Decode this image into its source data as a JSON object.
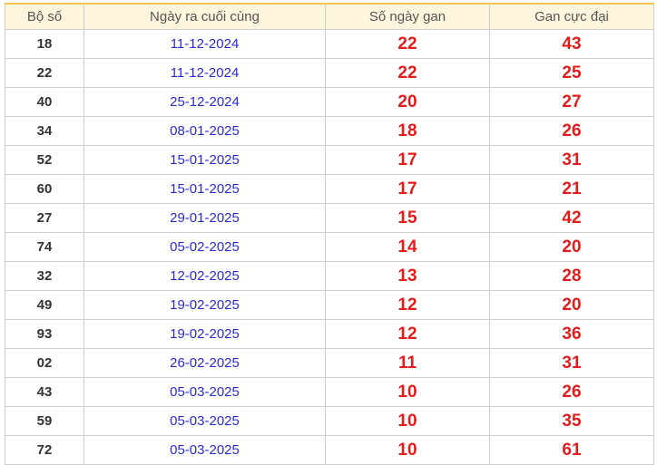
{
  "table": {
    "headers": [
      "Bộ số",
      "Ngày ra cuối cùng",
      "Số ngày gan",
      "Gan cực đại"
    ],
    "rows": [
      [
        "18",
        "11-12-2024",
        "22",
        "43"
      ],
      [
        "22",
        "11-12-2024",
        "22",
        "25"
      ],
      [
        "40",
        "25-12-2024",
        "20",
        "27"
      ],
      [
        "34",
        "08-01-2025",
        "18",
        "26"
      ],
      [
        "52",
        "15-01-2025",
        "17",
        "31"
      ],
      [
        "60",
        "15-01-2025",
        "17",
        "21"
      ],
      [
        "27",
        "29-01-2025",
        "15",
        "42"
      ],
      [
        "74",
        "05-02-2025",
        "14",
        "20"
      ],
      [
        "32",
        "12-02-2025",
        "13",
        "28"
      ],
      [
        "49",
        "19-02-2025",
        "12",
        "20"
      ],
      [
        "93",
        "19-02-2025",
        "12",
        "36"
      ],
      [
        "02",
        "26-02-2025",
        "11",
        "31"
      ],
      [
        "43",
        "05-03-2025",
        "10",
        "26"
      ],
      [
        "59",
        "05-03-2025",
        "10",
        "35"
      ],
      [
        "72",
        "05-03-2025",
        "10",
        "61"
      ]
    ]
  },
  "colors": {
    "header_bg": "#fdf6dc",
    "header_accent": "#f0c64a",
    "date_text": "#2a2ad0",
    "count_text": "#e41b1b",
    "border": "#cfcfcf"
  }
}
